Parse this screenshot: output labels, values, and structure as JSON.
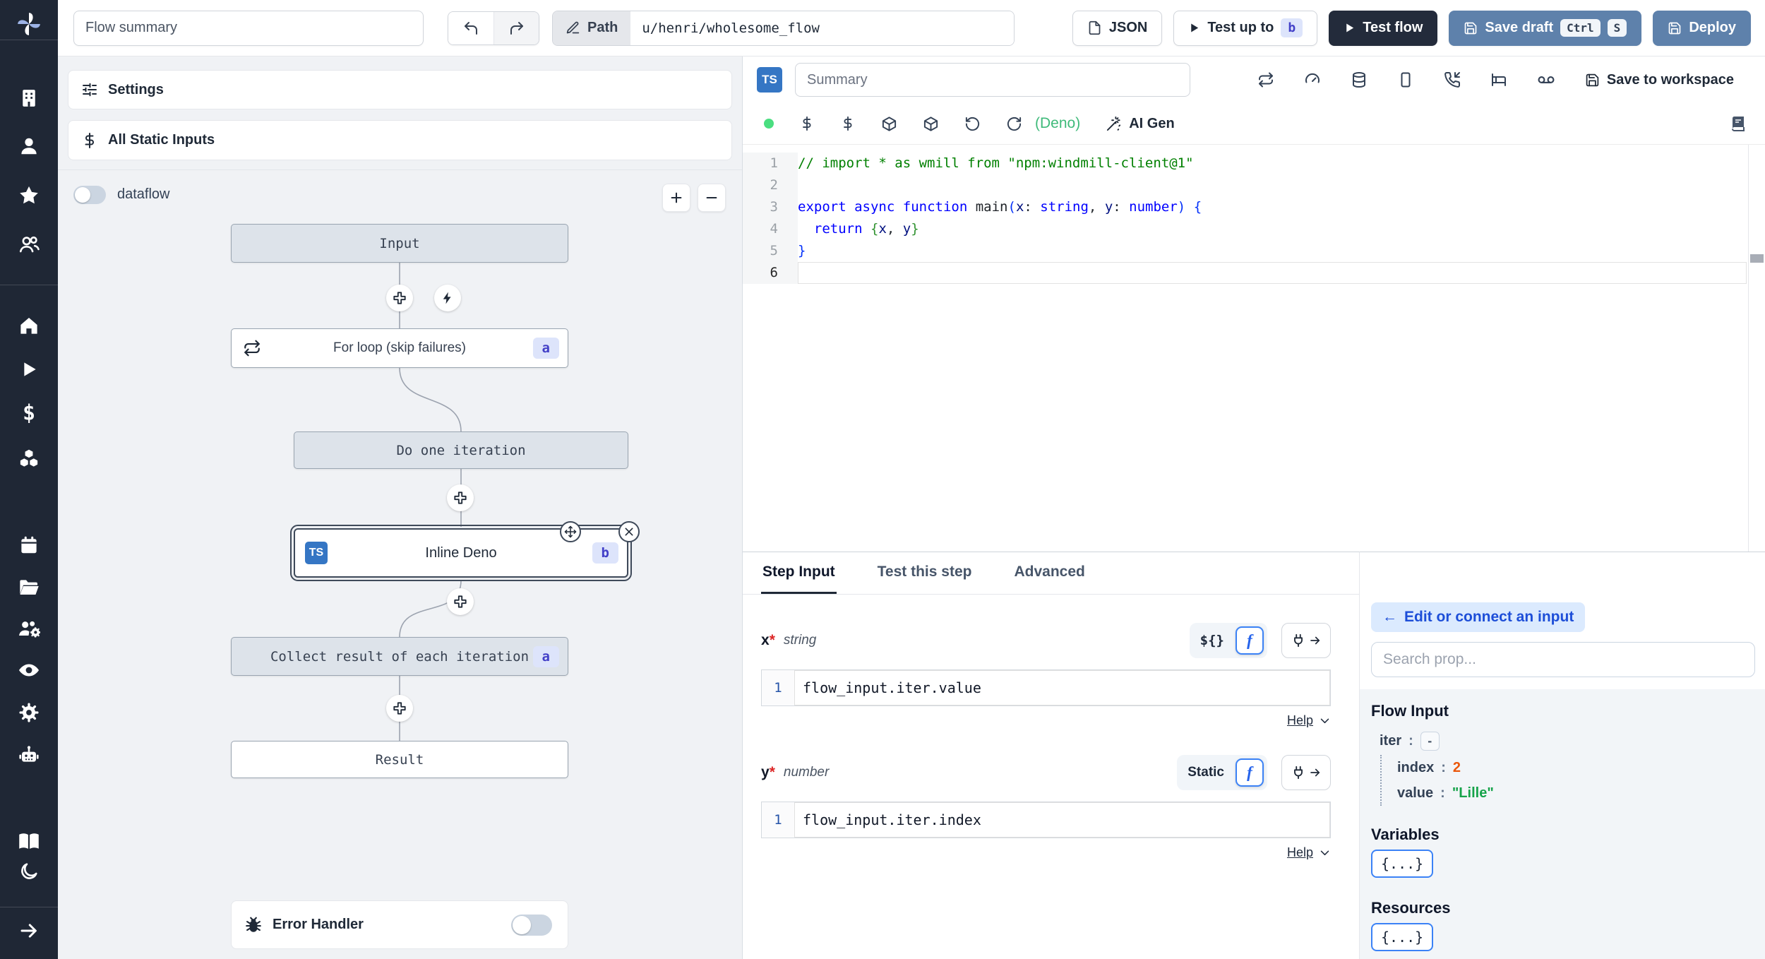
{
  "topbar": {
    "flow_summary_placeholder": "Flow summary",
    "path_label": "Path",
    "path_value": "u/henri/wholesome_flow",
    "json_button": "JSON",
    "test_up_to": "Test up to",
    "test_up_to_badge": "b",
    "test_flow": "Test flow",
    "save_draft": "Save draft",
    "kbd_ctrl": "Ctrl",
    "kbd_s": "S",
    "deploy": "Deploy"
  },
  "sidebar": {
    "icons": [
      "windmill-logo",
      "building",
      "user",
      "star",
      "users",
      "home",
      "play",
      "dollar",
      "boxes",
      "calendar",
      "folder-open",
      "users-cog",
      "eye",
      "gear",
      "bot",
      "book-open",
      "moon",
      "arrow-right"
    ]
  },
  "flow_panel": {
    "settings": "Settings",
    "all_static_inputs": "All Static Inputs",
    "dataflow": "dataflow",
    "nodes": {
      "input": "Input",
      "forloop": "For loop (skip failures)",
      "forloop_badge": "a",
      "do_one_iteration": "Do one iteration",
      "inline_deno": "Inline Deno",
      "inline_deno_badge": "b",
      "inline_deno_lang": "TS",
      "collect": "Collect result of each iteration",
      "collect_badge": "a",
      "result": "Result"
    },
    "error_handler": "Error Handler"
  },
  "editor": {
    "lang_badge": "TS",
    "summary_placeholder": "Summary",
    "save_to_workspace": "Save to workspace",
    "deno_label": "(Deno)",
    "ai_gen": "AI Gen",
    "status_color": "#4ade80",
    "code": [
      {
        "n": "1",
        "segs": [
          {
            "t": "// import * as wmill from \"npm:windmill-client@1\"",
            "c": "comment"
          }
        ]
      },
      {
        "n": "2",
        "segs": []
      },
      {
        "n": "3",
        "segs": [
          {
            "t": "export",
            "c": "kw"
          },
          {
            "t": " ",
            "c": "pl"
          },
          {
            "t": "async",
            "c": "kw"
          },
          {
            "t": " ",
            "c": "pl"
          },
          {
            "t": "function",
            "c": "kw"
          },
          {
            "t": " ",
            "c": "pl"
          },
          {
            "t": "main",
            "c": "fn"
          },
          {
            "t": "(",
            "c": "br1"
          },
          {
            "t": "x",
            "c": "var"
          },
          {
            "t": ": ",
            "c": "pl"
          },
          {
            "t": "string",
            "c": "kw"
          },
          {
            "t": ", ",
            "c": "pl"
          },
          {
            "t": "y",
            "c": "var"
          },
          {
            "t": ": ",
            "c": "pl"
          },
          {
            "t": "number",
            "c": "kw"
          },
          {
            "t": ")",
            "c": "br1"
          },
          {
            "t": " ",
            "c": "pl"
          },
          {
            "t": "{",
            "c": "br2"
          }
        ]
      },
      {
        "n": "4",
        "segs": [
          {
            "t": "  ",
            "c": "pl"
          },
          {
            "t": "return",
            "c": "kw"
          },
          {
            "t": " ",
            "c": "pl"
          },
          {
            "t": "{",
            "c": "br3"
          },
          {
            "t": "x",
            "c": "var"
          },
          {
            "t": ", ",
            "c": "pl"
          },
          {
            "t": "y",
            "c": "var"
          },
          {
            "t": "}",
            "c": "br3"
          }
        ]
      },
      {
        "n": "5",
        "segs": [
          {
            "t": "}",
            "c": "br2"
          }
        ]
      },
      {
        "n": "6",
        "segs": [],
        "active": true
      }
    ]
  },
  "step_panel": {
    "tabs": [
      "Step Input",
      "Test this step",
      "Advanced"
    ],
    "fields": [
      {
        "label": "x",
        "required": "*",
        "type": "string",
        "mode_label": "${}",
        "fn_label": "f",
        "line_no": "1",
        "expr": "flow_input.iter.value",
        "help": "Help"
      },
      {
        "label": "y",
        "required": "*",
        "type": "number",
        "mode_label": "Static",
        "fn_label": "f",
        "line_no": "1",
        "expr": "flow_input.iter.index",
        "help": "Help"
      }
    ]
  },
  "connect_panel": {
    "back_arrow": "←",
    "back_label": "Edit or connect an input",
    "search_placeholder": "Search prop...",
    "flow_input_title": "Flow Input",
    "tree": {
      "iter_key": "iter",
      "iter_sep": ":",
      "collapse": "-",
      "index_key": "index",
      "index_sep": ":",
      "index_value": "2",
      "value_key": "value",
      "value_sep": ":",
      "value_value": "\"Lille\""
    },
    "variables_title": "Variables",
    "variables_button": "{...}",
    "resources_title": "Resources",
    "resources_button": "{...}"
  },
  "colors": {
    "sidebar_bg": "#1f2735",
    "primary_button": "#5e81ab",
    "dark_button": "#232b3b",
    "badge_bg": "#dde4fb",
    "badge_text": "#4340c8",
    "connect_pill_bg": "#dbeafe",
    "connect_pill_text": "#1d4ed8",
    "number_value": "#ea580c",
    "string_value": "#16a34a",
    "deno_green": "#3fba7a"
  }
}
